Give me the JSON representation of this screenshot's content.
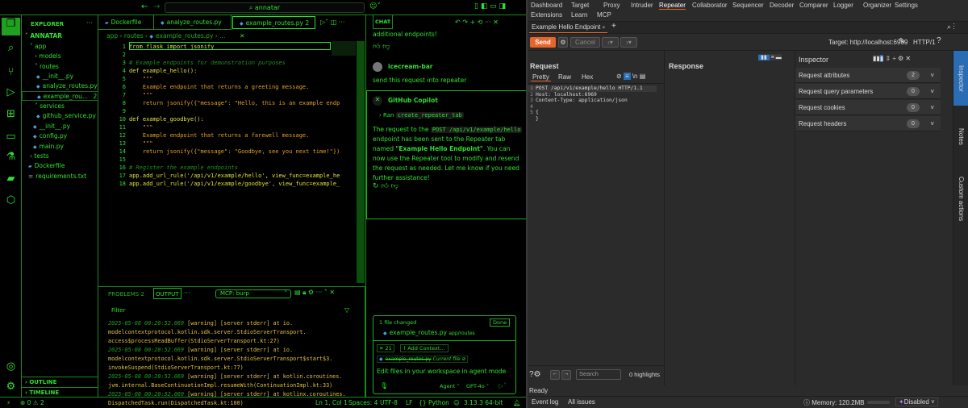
{
  "vscode": {
    "search": "annatar",
    "explorer": {
      "title": "EXPLORER",
      "root": "ANNATAR",
      "items": [
        {
          "label": "app"
        },
        {
          "label": "models"
        },
        {
          "label": "routes"
        },
        {
          "label": "__init__.py"
        },
        {
          "label": "analyze_routes.py"
        },
        {
          "label": "example_rou...",
          "badge": "2"
        },
        {
          "label": "services"
        },
        {
          "label": "github_service.py"
        },
        {
          "label": "__init__.py"
        },
        {
          "label": "config.py"
        },
        {
          "label": "main.py"
        },
        {
          "label": "tests"
        },
        {
          "label": "Dockerfile"
        },
        {
          "label": "requirements.txt"
        }
      ],
      "outline": "OUTLINE",
      "timeline": "TIMELINE"
    },
    "tabs": [
      {
        "label": "Dockerfile"
      },
      {
        "label": "analyze_routes.py"
      },
      {
        "label": "example_routes.py",
        "badge": "2"
      }
    ],
    "breadcrumb": [
      "app",
      "routes",
      "example_routes.py",
      "..."
    ],
    "code": [
      [
        "1",
        "from flask import jsonify"
      ],
      [
        "2",
        ""
      ],
      [
        "3",
        "# Example endpoints for demonstration purposes"
      ],
      [
        "4",
        "def example_hello():"
      ],
      [
        "5",
        "    \"\"\""
      ],
      [
        "6",
        "    Example endpoint that returns a greeting message."
      ],
      [
        "7",
        "    \"\"\""
      ],
      [
        "8",
        "    return jsonify({\"message\": \"Hello, this is an example endp"
      ],
      [
        "9",
        ""
      ],
      [
        "10",
        "def example_goodbye():"
      ],
      [
        "11",
        "    \"\"\""
      ],
      [
        "12",
        "    Example endpoint that returns a farewell message."
      ],
      [
        "13",
        "    \"\"\""
      ],
      [
        "14",
        "    return jsonify({\"message\": \"Goodbye, see you next time!\"})"
      ],
      [
        "15",
        ""
      ],
      [
        "16",
        "# Register the example endpoints"
      ],
      [
        "17",
        "app.add_url_rule('/api/v1/example/hello', view_func=example_he"
      ],
      [
        "18",
        "app.add_url_rule('/api/v1/example/goodbye', view_func=example_"
      ]
    ],
    "panel": {
      "problems": "PROBLEMS",
      "problems_count": "2",
      "output": "OUTPUT",
      "channel": "MCP: burp",
      "filter": "Filter",
      "log": [
        [
          "2025-05-08 00:20:52.069",
          "[warning] [server stderr]   at io."
        ],
        [
          "",
          "modelcontextprotocol.kotlin.sdk.server.StdioServerTransport."
        ],
        [
          "",
          "access$processReadBuffer(StdioServerTransport.kt:27)"
        ],
        [
          "2025-05-08 00:20:52.069",
          "[warning] [server stderr]   at io."
        ],
        [
          "",
          "modelcontextprotocol.kotlin.sdk.server.StdioServerTransport$start$3."
        ],
        [
          "",
          "invokeSuspend(StdioServerTransport.kt:77)"
        ],
        [
          "2025-05-08 00:20:52.069",
          "[warning] [server stderr]   at kotlin.coroutines."
        ],
        [
          "",
          "jvm.internal.BaseContinuationImpl.resumeWith(ContinuationImpl.kt:33)"
        ],
        [
          "2025-05-08 00:20:52.069",
          "[warning] [server stderr]   at kotlinx.coroutines."
        ],
        [
          "",
          "DispatchedTask.run(DispatchedTask.kt:100)"
        ]
      ]
    },
    "chat": {
      "title": "CHAT",
      "prev": "additional endpoints!",
      "user": "icecream-bar",
      "user_msg": "send this request into repeater",
      "bot": "GitHub Copilot",
      "ran": "Ran",
      "tool": "create_repeater_tab",
      "r1": "The request to the",
      "r_code": "POST /api/v1/example/hello",
      "r2": "endpoint has been sent to the Repeater tab named",
      "r_bold": "\"Example Hello Endpoint\"",
      "r3": ". You can now use the Repeater tool to modify and resend the request as needed. Let me know if you need further assistance!",
      "files_changed": "1 file changed",
      "done": "Done",
      "file": "example_routes.py",
      "file_path": "app/routes",
      "tools_count": "21",
      "add_context": "Add Context...",
      "current_file": "example_routes.py",
      "current_file_label": "Current file",
      "placeholder": "Edit files in your workspace in agent mode",
      "mode": "Agent",
      "model": "GPT-4o"
    },
    "status": {
      "errors": "0",
      "warnings": "2",
      "position": "Ln 1, Col 1",
      "spaces": "Spaces: 4",
      "encoding": "UTF-8",
      "eol": "LF",
      "language": "Python",
      "python": "3.13.3 64-bit"
    }
  },
  "burp": {
    "menu1": [
      "Dashboard",
      "Target",
      "Proxy",
      "Intruder",
      "Repeater",
      "Collaborator",
      "Sequencer",
      "Decoder",
      "Comparer",
      "Logger",
      "Organizer",
      "Settings"
    ],
    "menu2": [
      "Extensions",
      "Learn",
      "MCP"
    ],
    "tab": "Example Hello Endpoint",
    "send": "Send",
    "cancel": "Cancel",
    "target": "Target: http://localhost:6969",
    "http": "HTTP/1",
    "request": {
      "title": "Request",
      "tabs": [
        "Pretty",
        "Raw",
        "Hex"
      ],
      "lines": [
        [
          "1",
          "POST /api/v1/example/hello HTTP/1.1"
        ],
        [
          "2",
          "Host: localhost:6969"
        ],
        [
          "3",
          "Content-Type: application/json"
        ],
        [
          "4",
          ""
        ],
        [
          "5",
          "{"
        ],
        [
          "",
          "}"
        ]
      ]
    },
    "response": {
      "title": "Response"
    },
    "inspector": {
      "title": "Inspector",
      "rows": [
        {
          "label": "Request attributes",
          "count": "2"
        },
        {
          "label": "Request query parameters",
          "count": "0"
        },
        {
          "label": "Request cookies",
          "count": "0"
        },
        {
          "label": "Request headers",
          "count": "0"
        }
      ]
    },
    "side": [
      "Inspector",
      "Notes",
      "Custom actions"
    ],
    "search_placeholder": "Search",
    "highlights": "0 highlights",
    "ready": "Ready",
    "bottom": {
      "event_log": "Event log",
      "all_issues": "All issues",
      "memory": "Memory: 120.2MB",
      "ai": "Disabled"
    },
    "colors": {
      "send": "#e8652a",
      "accent": "#2a6db5"
    }
  }
}
